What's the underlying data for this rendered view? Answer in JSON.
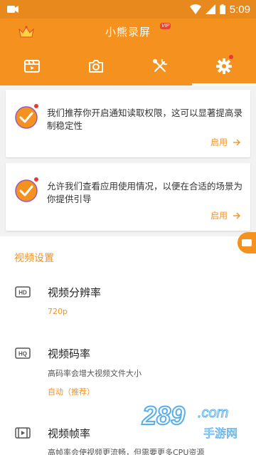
{
  "status_bar": {
    "time": "5:09"
  },
  "app": {
    "title": "小熊录屏",
    "vip_badge": "VIP"
  },
  "tabs": [
    {
      "name": "video-list-icon"
    },
    {
      "name": "camera-icon"
    },
    {
      "name": "tools-icon"
    },
    {
      "name": "settings-icon",
      "active": true,
      "has_dot": true
    }
  ],
  "cards": [
    {
      "text": "我们推荐你开启通知读取权限，这可以显著提高录制稳定性",
      "action": "启用"
    },
    {
      "text": "允许我们查看应用使用情况，以便在合适的场景为你提供引导",
      "action": "启用"
    }
  ],
  "section": {
    "title": "视频设置"
  },
  "settings": [
    {
      "title": "视频分辨率",
      "value": "720p"
    },
    {
      "title": "视频码率",
      "desc": "高码率会增大视频文件大小",
      "value": "自动（推荐）"
    },
    {
      "title": "视频帧率",
      "desc": "高帧率会使视频更流畅，但需要更多CPU资源"
    }
  ],
  "watermark": {
    "text": "289.com",
    "sub": "手游网"
  },
  "colors": {
    "accent": "#f5921f",
    "status_bar": "#e8891e",
    "dot": "#e53935"
  }
}
